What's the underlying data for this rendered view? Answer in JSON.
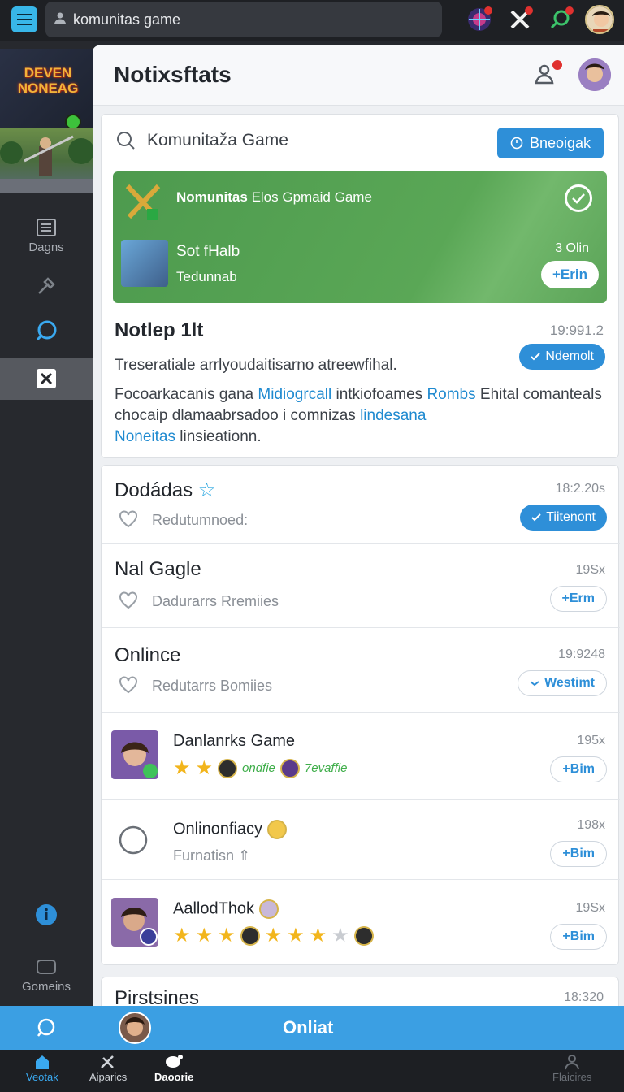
{
  "topbar": {
    "search_value": "komunitas game"
  },
  "sidebar": {
    "logo_text": "DEVEN NONEAG",
    "items": [
      {
        "label": "Dagns"
      },
      {
        "label": ""
      },
      {
        "label": ""
      },
      {
        "label": ""
      },
      {
        "label": "Gomeins"
      }
    ]
  },
  "main": {
    "title": "Notixsftats",
    "search": {
      "placeholder": "Komunitaža Game",
      "button": "Bneoigak"
    },
    "featured": {
      "title_bold": "Nomunitas",
      "title_rest": " Elos Gpmaid Game",
      "name": "Sot fHalb",
      "sub": "Tedunnab",
      "count": "3 Olin",
      "join": "+Erin"
    },
    "post": {
      "title": "Notlep 1lt",
      "time": "19:991.2",
      "subtitle": "Treseratiale arrlyoudaitisarno atreewfihal.",
      "follow": "Ndemolt",
      "body_1": "Focoarkacanis gana ",
      "link_1": "Midiogrcall",
      "body_2": " intkiofoames ",
      "link_2": "Rombs",
      "body_3": " Ehital comanteals chocaip dlamaabrsadoo i comnizas ",
      "link_3": "lindesana",
      "link_4": "Noneitas",
      "body_4": " linsieationn."
    },
    "rows": [
      {
        "title": "Dodádas",
        "sub": "Redutumnoed:",
        "time": "18:2.20s",
        "action": "Tiitenont"
      },
      {
        "title": "Nal Gagle",
        "sub": "Dadurarrs Rremiies",
        "time": "19Sx",
        "action": "+Erm"
      },
      {
        "title": "Onlince",
        "sub": "Redutarrs Bomiies",
        "time": "19:9248",
        "action": "Westimt"
      },
      {
        "title": "Danlanrks Game",
        "tag1": "ondfie",
        "tag2": "7evaffie",
        "time": "195x",
        "action": "+Bim"
      },
      {
        "title": "Onlinonfiacy",
        "sub": "Furnatisn",
        "time": "198x",
        "action": "+Bim"
      },
      {
        "title": "AallodThok",
        "time": "19Sx",
        "action": "+Bim"
      }
    ],
    "last": {
      "title": "Pirstsines",
      "time": "18:320"
    }
  },
  "bottom": {
    "online_label": "Onliat",
    "nav": [
      {
        "label": "Veotak"
      },
      {
        "label": "Aiparics"
      },
      {
        "label": "Daoorie"
      },
      {
        "label": "Flaicires"
      }
    ]
  }
}
